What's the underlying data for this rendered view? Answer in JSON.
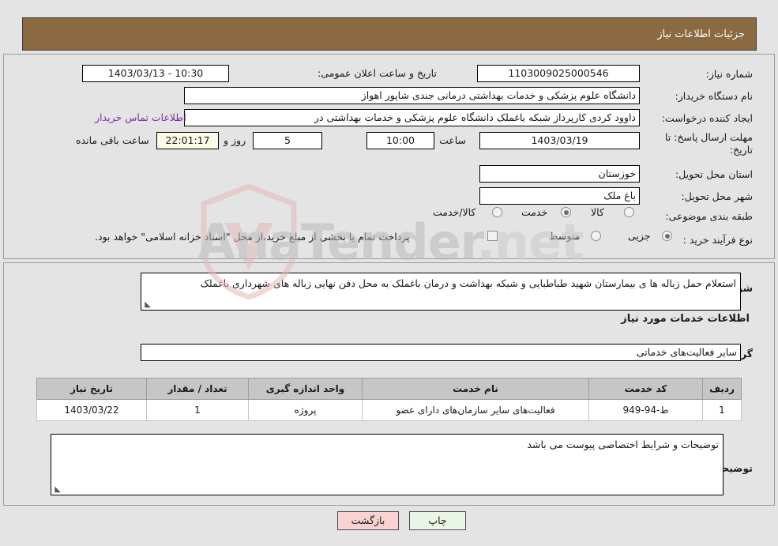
{
  "header": {
    "title": "جزئیات اطلاعات نیاز"
  },
  "need": {
    "number_label": "شماره نیاز:",
    "number_value": "1103009025000546",
    "announce_label": "تاریخ و ساعت اعلان عمومی:",
    "announce_value": "10:30 - 1403/03/13",
    "buyer_org_label": "نام دستگاه خریدار:",
    "buyer_org_value": "دانشگاه علوم پزشکی و خدمات بهداشتی درمانی جندی شاپور اهواز",
    "creator_label": "ایجاد کننده درخواست:",
    "creator_value": "داوود کردی کارپرداز شبکه باغملک دانشگاه علوم پزشکی و خدمات بهداشتی در",
    "contact_link": "اطلاعات تماس خریدار",
    "deadline_label_line1": "مهلت ارسال پاسخ: تا",
    "deadline_label_line2": "تاریخ:",
    "deadline_date": "1403/03/19",
    "deadline_hour_label": "ساعت",
    "deadline_hour": "10:00",
    "remaining_days": "5",
    "remaining_days_label": "روز و",
    "remaining_time": "22:01:17",
    "remaining_time_label": "ساعت باقی مانده",
    "province_label": "استان محل تحویل:",
    "province_value": "خوزستان",
    "city_label": "شهر محل تحویل:",
    "city_value": "باغ ملک",
    "category_label": "طبقه بندی موضوعی:",
    "category_options": [
      {
        "label": "کالا",
        "selected": false
      },
      {
        "label": "خدمت",
        "selected": true
      },
      {
        "label": "کالا/خدمت",
        "selected": false
      }
    ],
    "process_label": "نوع فرآیند خرید :",
    "process_options": [
      {
        "label": "جزیی",
        "selected": true
      },
      {
        "label": "متوسط",
        "selected": false
      }
    ],
    "treasury_checkbox_checked": false,
    "treasury_note": "پرداخت تمام یا بخشی از مبلغ خرید،از محل \"اسناد خزانه اسلامی\" خواهد بود."
  },
  "summary": {
    "label": "شرح کلی نیاز:",
    "value": "استعلام حمل زباله ها ی بیمارستان شهید طباطبایی و شبکه بهداشت و درمان باغملک به محل دفن نهایی زباله های شهرداری باغملک"
  },
  "services_section": {
    "heading": "اطلاعات خدمات مورد نیاز",
    "group_label": "گروه خدمت:",
    "group_value": "سایر فعالیت‌های خدماتی",
    "columns": [
      "ردیف",
      "کد خدمت",
      "نام خدمت",
      "واحد اندازه گیری",
      "تعداد / مقدار",
      "تاریخ نیاز"
    ],
    "rows": [
      {
        "row": "1",
        "code": "ط-94-949",
        "name": "فعالیت‌های سایر سازمان‌های دارای عضو",
        "unit": "پروژه",
        "qty": "1",
        "date": "1403/03/22"
      }
    ]
  },
  "buyer_notes": {
    "label": "توضیحات خریدار:",
    "value": "توضیحات و شرایط اختصاصی پیوست می باشد"
  },
  "footer": {
    "print_label": "چاپ",
    "back_label": "بازگشت"
  },
  "watermark": {
    "text": "AnaTender",
    "suffix": ".net"
  },
  "colors": {
    "header_bg": "#8b6a41",
    "link": "#7a2fa8",
    "table_header_bg": "#c6c6c6",
    "print_btn_bg": "#e9f6e6",
    "back_btn_bg": "#f9d2d2",
    "countdown_bg": "#fbfbe8"
  }
}
